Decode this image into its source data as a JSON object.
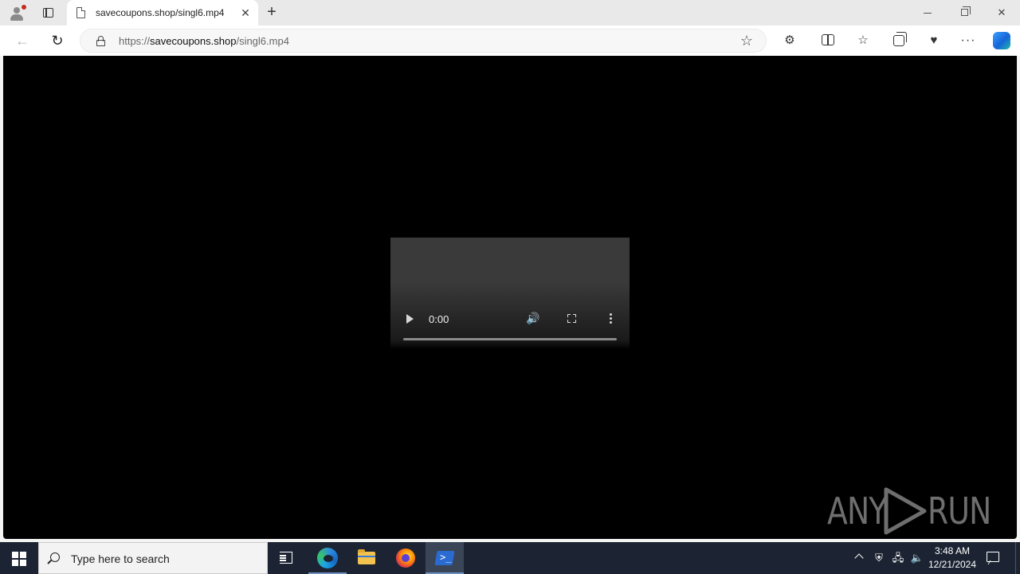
{
  "browser": {
    "tab": {
      "title": "savecoupons.shop/singl6.mp4",
      "close_glyph": "✕"
    },
    "new_tab_glyph": "+",
    "window_controls": {
      "close_glyph": "✕"
    },
    "address": {
      "scheme": "https://",
      "domain": "savecoupons.shop",
      "path": "/singl6.mp4"
    },
    "icons": [
      "profile-icon",
      "tab-actions-icon",
      "back-icon",
      "reload-icon",
      "lock-icon",
      "favorite-star-icon",
      "extensions-icon",
      "split-screen-icon",
      "favorites-icon",
      "collections-icon",
      "performance-icon",
      "more-icon",
      "copilot-icon"
    ]
  },
  "video_player": {
    "current_time": "0:00",
    "progress_fraction": 0
  },
  "watermark": {
    "left": "ANY",
    "right": "RUN"
  },
  "taskbar": {
    "search_placeholder": "Type here to search",
    "clock_time": "3:48 AM",
    "clock_date": "12/21/2024",
    "accent_color": "#6e8fbf"
  }
}
